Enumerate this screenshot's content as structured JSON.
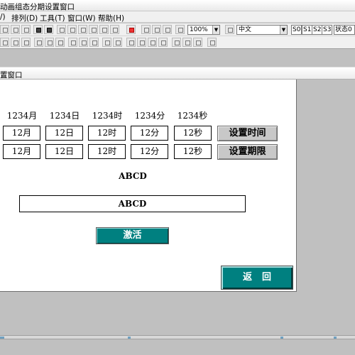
{
  "app_title": "动画组态分期设置窗口",
  "menu": [
    {
      "label": "/)"
    },
    {
      "label": "排列(D)"
    },
    {
      "label": "工具(T)"
    },
    {
      "label": "窗口(W)"
    },
    {
      "label": "帮助(H)"
    }
  ],
  "toolbar": {
    "zoom_value": "100%",
    "language_value": "中文",
    "state_buttons": [
      "S0",
      "S1",
      "S2",
      "S3"
    ],
    "state_value": "状态0"
  },
  "dialog": {
    "title": "置窗口",
    "column_labels": [
      "1234月",
      "1234日",
      "1234时",
      "1234分",
      "1234秒"
    ],
    "time_row": [
      "12月",
      "12日",
      "12时",
      "12分",
      "12秒"
    ],
    "limit_row": [
      "12月",
      "12日",
      "12时",
      "12分",
      "12秒"
    ],
    "set_time_button": "设置时间",
    "set_limit_button": "设置期限",
    "code_label": "ABCD",
    "code_field": "ABCD",
    "activate_button": "激活",
    "return_button": "返回"
  },
  "colors": {
    "accent_teal": "#008080",
    "background_gray": "#c0c0c0"
  }
}
